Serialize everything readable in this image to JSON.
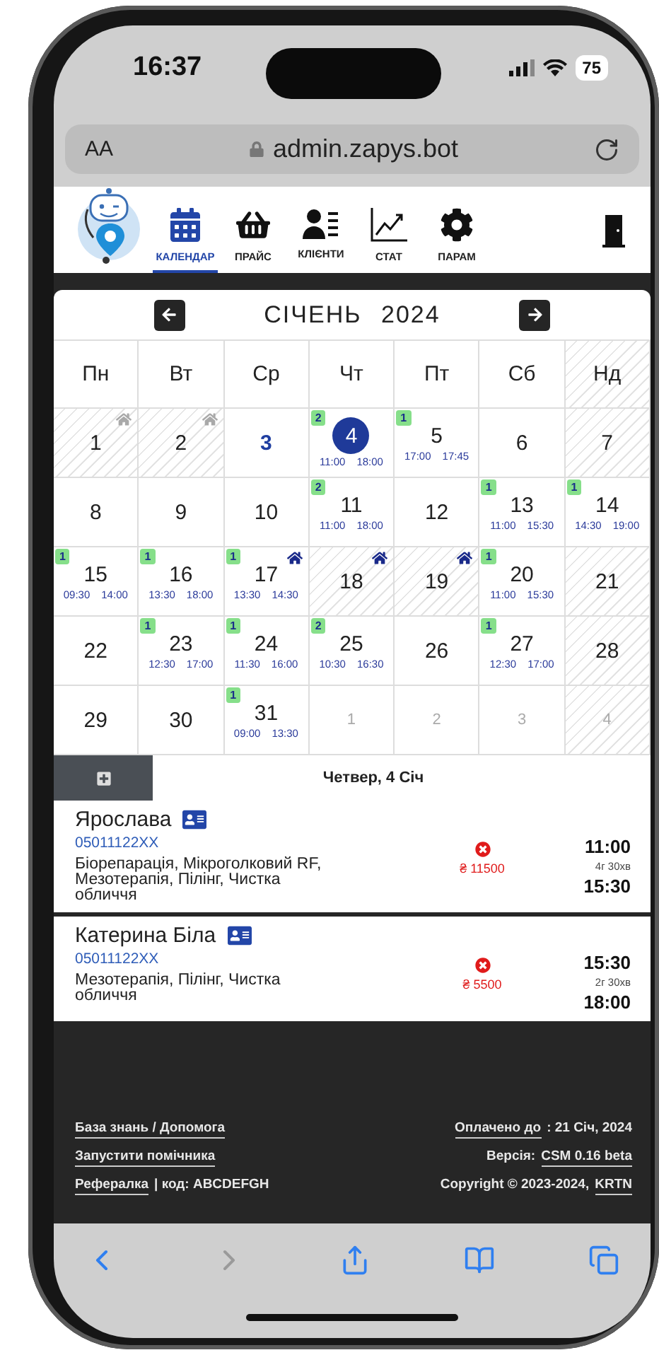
{
  "status_bar": {
    "time": "16:37",
    "battery": "75"
  },
  "browser": {
    "text_size": "AA",
    "url": "admin.zapys.bot"
  },
  "nav": [
    {
      "kind": "calendar",
      "label": "КАЛЕНДАР",
      "selected": true
    },
    {
      "kind": "basket",
      "label": "ПРАЙС",
      "selected": false
    },
    {
      "kind": "clients",
      "label": "КЛІЄНТИ",
      "selected": false
    },
    {
      "kind": "stats",
      "label": "СТАТ",
      "selected": false
    },
    {
      "kind": "settings",
      "label": "ПАРАМ",
      "selected": false
    }
  ],
  "calendar": {
    "month": "СІЧЕНЬ",
    "year": "2024",
    "weekdays": [
      {
        "label": "Пн",
        "off": false
      },
      {
        "label": "Вт",
        "off": false
      },
      {
        "label": "Ср",
        "off": false
      },
      {
        "label": "Чт",
        "off": false
      },
      {
        "label": "Пт",
        "off": false
      },
      {
        "label": "Сб",
        "off": false
      },
      {
        "label": "Нд",
        "off": true
      }
    ],
    "weeks": [
      [
        {
          "label": "1",
          "kind": "day",
          "selected": false,
          "off": true,
          "home": true,
          "home_active": false
        },
        {
          "label": "2",
          "kind": "day",
          "selected": false,
          "off": true,
          "home": true,
          "home_active": false
        },
        {
          "label": "3",
          "kind": "today",
          "selected": false,
          "off": false
        },
        {
          "label": "4",
          "kind": "day",
          "selected": true,
          "off": false,
          "count": "2",
          "start": "11:00",
          "end": "18:00"
        },
        {
          "label": "5",
          "kind": "day",
          "selected": false,
          "off": false,
          "count": "1",
          "start": "17:00",
          "end": "17:45"
        },
        {
          "label": "6",
          "kind": "day",
          "selected": false,
          "off": false
        },
        {
          "label": "7",
          "kind": "day",
          "selected": false,
          "off": true
        }
      ],
      [
        {
          "label": "8",
          "kind": "day",
          "selected": false,
          "off": false
        },
        {
          "label": "9",
          "kind": "day",
          "selected": false,
          "off": false
        },
        {
          "label": "10",
          "kind": "day",
          "selected": false,
          "off": false
        },
        {
          "label": "11",
          "kind": "day",
          "selected": false,
          "off": false,
          "count": "2",
          "start": "11:00",
          "end": "18:00"
        },
        {
          "label": "12",
          "kind": "day",
          "selected": false,
          "off": false
        },
        {
          "label": "13",
          "kind": "day",
          "selected": false,
          "off": false,
          "count": "1",
          "start": "11:00",
          "end": "15:30"
        },
        {
          "label": "14",
          "kind": "day",
          "selected": false,
          "off": false,
          "count": "1",
          "start": "14:30",
          "end": "19:00"
        }
      ],
      [
        {
          "label": "15",
          "kind": "day",
          "selected": false,
          "off": false,
          "count": "1",
          "start": "09:30",
          "end": "14:00"
        },
        {
          "label": "16",
          "kind": "day",
          "selected": false,
          "off": false,
          "count": "1",
          "start": "13:30",
          "end": "18:00"
        },
        {
          "label": "17",
          "kind": "day",
          "selected": false,
          "off": false,
          "count": "1",
          "start": "13:30",
          "end": "14:30",
          "home": true,
          "home_active": true
        },
        {
          "label": "18",
          "kind": "day",
          "selected": false,
          "off": true,
          "home": true,
          "home_active": true
        },
        {
          "label": "19",
          "kind": "day",
          "selected": false,
          "off": true,
          "home": true,
          "home_active": true
        },
        {
          "label": "20",
          "kind": "day",
          "selected": false,
          "off": false,
          "count": "1",
          "start": "11:00",
          "end": "15:30"
        },
        {
          "label": "21",
          "kind": "day",
          "selected": false,
          "off": true
        }
      ],
      [
        {
          "label": "22",
          "kind": "day",
          "selected": false,
          "off": false
        },
        {
          "label": "23",
          "kind": "day",
          "selected": false,
          "off": false,
          "count": "1",
          "start": "12:30",
          "end": "17:00"
        },
        {
          "label": "24",
          "kind": "day",
          "selected": false,
          "off": false,
          "count": "1",
          "start": "11:30",
          "end": "16:00"
        },
        {
          "label": "25",
          "kind": "day",
          "selected": false,
          "off": false,
          "count": "2",
          "start": "10:30",
          "end": "16:30"
        },
        {
          "label": "26",
          "kind": "day",
          "selected": false,
          "off": false
        },
        {
          "label": "27",
          "kind": "day",
          "selected": false,
          "off": false,
          "count": "1",
          "start": "12:30",
          "end": "17:00"
        },
        {
          "label": "28",
          "kind": "day",
          "selected": false,
          "off": true
        }
      ],
      [
        {
          "label": "29",
          "kind": "day",
          "selected": false,
          "off": false
        },
        {
          "label": "30",
          "kind": "day",
          "selected": false,
          "off": false
        },
        {
          "label": "31",
          "kind": "day",
          "selected": false,
          "off": false,
          "count": "1",
          "start": "09:00",
          "end": "13:30"
        },
        {
          "label": "1",
          "kind": "other",
          "selected": false,
          "off": false
        },
        {
          "label": "2",
          "kind": "other",
          "selected": false,
          "off": false
        },
        {
          "label": "3",
          "kind": "other",
          "selected": false,
          "off": false
        },
        {
          "label": "4",
          "kind": "other",
          "selected": false,
          "off": true
        }
      ]
    ]
  },
  "day_detail": {
    "title": "Четвер, 4 Січ",
    "appointments": [
      {
        "name": "Ярослава",
        "phone": "05011122XX",
        "services": "Біорепарація, Мікроголковий RF, Мезотерапія, Пілінг, Чистка обличчя",
        "paid": false,
        "price": "₴ 11500",
        "start": "11:00",
        "duration": "4г 30хв",
        "end": "15:30"
      },
      {
        "name": "Катерина Біла",
        "phone": "05011122XX",
        "services": "Мезотерапія, Пілінг, Чистка обличчя",
        "paid": false,
        "price": "₴ 5500",
        "start": "15:30",
        "duration": "2г 30хв",
        "end": "18:00"
      }
    ]
  },
  "footer": {
    "left": [
      [
        {
          "kind": "link",
          "text": "База знань / Допомога"
        }
      ],
      [
        {
          "kind": "link",
          "text": "Запустити помічника"
        }
      ],
      [
        {
          "kind": "link",
          "text": "Рефералка"
        },
        {
          "kind": "text",
          "text": "| код: ABCDEFGH"
        }
      ]
    ],
    "right": [
      [
        {
          "kind": "link",
          "text": "Оплачено до"
        },
        {
          "kind": "text",
          "text": ": 21 Січ, 2024"
        }
      ],
      [
        {
          "kind": "text",
          "text": "Версія:"
        },
        {
          "kind": "link",
          "text": "CSM 0.16 beta"
        }
      ],
      [
        {
          "kind": "text",
          "text": "Copyright © 2023-2024,"
        },
        {
          "kind": "link",
          "text": "KRTN"
        }
      ]
    ]
  }
}
